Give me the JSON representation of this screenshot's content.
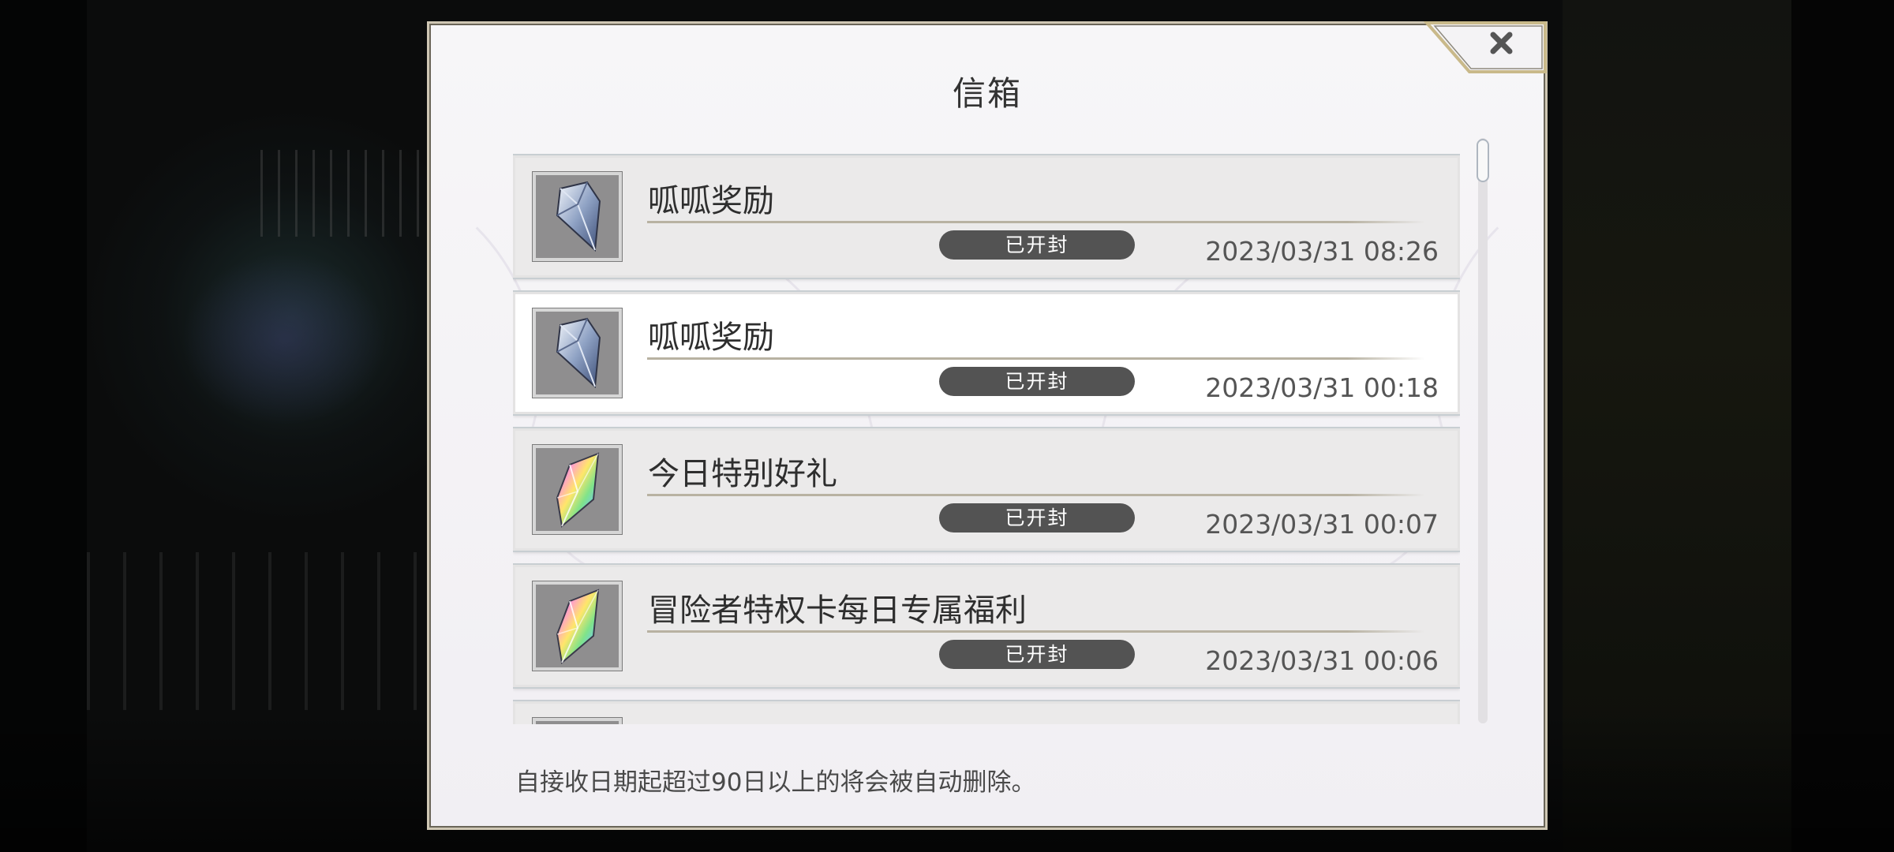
{
  "dialog": {
    "title": "信箱",
    "close_icon": "close-x-icon",
    "footer_note": "自接收日期起超过90日以上的将会被自动删除。"
  },
  "mails": [
    {
      "title": "呱呱奖励",
      "status": "已开封",
      "date": "2023/03/31 08:26",
      "icon": "blue-crystal-icon"
    },
    {
      "title": "呱呱奖励",
      "status": "已开封",
      "date": "2023/03/31 00:18",
      "icon": "blue-crystal-icon"
    },
    {
      "title": "今日特别好礼",
      "status": "已开封",
      "date": "2023/03/31 00:07",
      "icon": "rainbow-crystal-icon"
    },
    {
      "title": "冒险者特权卡每日专属福利",
      "status": "已开封",
      "date": "2023/03/31 00:06",
      "icon": "rainbow-crystal-icon"
    }
  ],
  "colors": {
    "panel": "#f3f1f5",
    "status_badge": "#535353",
    "gold_frame": "#c9b98a"
  }
}
